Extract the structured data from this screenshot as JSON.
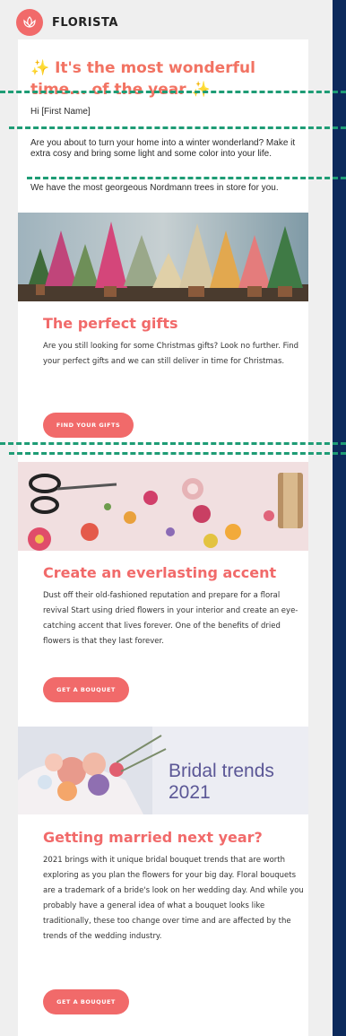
{
  "brand": {
    "name": "FLORISTA"
  },
  "intro": {
    "headline_spark": "✨",
    "headline_text": "It's the most wonderful time... of the year",
    "greeting": "Hi [First Name]",
    "paragraph1": "Are you about to turn your home into a winter wonderland? Make it extra cosy and bring some light and some color into your life.",
    "paragraph2": "We have the most georgeous Nordmann trees in store for you."
  },
  "sections": [
    {
      "title": "The perfect gifts",
      "body": "Are you still looking for some Christmas gifts? Look no further. Find your perfect gifts and we can still deliver in time for Christmas.",
      "button": "FIND YOUR GIFTS"
    },
    {
      "title": "Create an everlasting accent",
      "body": "Dust off their old-fashioned reputation and prepare for a floral revival Start using dried flowers in your interior and create an eye-catching accent that lives forever. One of the benefits of dried flowers is that they last forever.",
      "button": "GET A BOUQUET"
    },
    {
      "title": "Getting married next year?",
      "image_caption": "Bridal trends 2021",
      "body": "2021 brings with it unique bridal bouquet trends that are worth exploring as you plan the flowers for your big day. Floral bouquets are a trademark of a bride's look on her wedding day. And while you probably have a general idea of what a bouquet looks like traditionally, these too change over time and are affected by the trends of the wedding industry.",
      "button": "GET A BOUQUET"
    }
  ],
  "colors": {
    "accent": "#f16a6a",
    "spark": "#f5bb3f",
    "guide": "#1e9c75",
    "sidebar": "#0d2a5c"
  }
}
